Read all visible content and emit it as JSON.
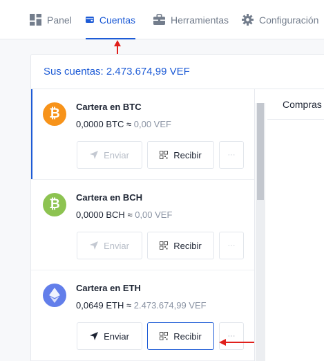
{
  "nav": {
    "items": [
      {
        "label": "Panel",
        "icon": "dashboard-icon"
      },
      {
        "label": "Cuentas",
        "icon": "wallet-icon",
        "active": true
      },
      {
        "label": "Herramientas",
        "icon": "briefcase-icon"
      },
      {
        "label": "Configuración",
        "icon": "gear-icon"
      }
    ]
  },
  "accounts": {
    "total_label": "Sus cuentas: 2.473.674,99 VEF"
  },
  "wallets": [
    {
      "name": "Cartera en BTC",
      "amount": "0,0000 BTC",
      "approx": "≈",
      "fiat": "0,00 VEF",
      "coin_icon": "bitcoin-icon",
      "coin_color": "#f7931a",
      "coin_symbol": "₿",
      "send_label": "Enviar",
      "receive_label": "Recibir",
      "more_label": "···",
      "send_enabled": false
    },
    {
      "name": "Cartera en BCH",
      "amount": "0,0000 BCH",
      "approx": "≈",
      "fiat": "0,00 VEF",
      "coin_icon": "bitcoin-cash-icon",
      "coin_color": "#8dc351",
      "coin_symbol": "₿",
      "send_label": "Enviar",
      "receive_label": "Recibir",
      "more_label": "···",
      "send_enabled": false
    },
    {
      "name": "Cartera en ETH",
      "amount": "0,0649 ETH",
      "approx": "≈",
      "fiat": "2.473.674,99 VEF",
      "coin_icon": "ethereum-icon",
      "coin_color": "#627eea",
      "coin_symbol": "◆",
      "send_label": "Enviar",
      "receive_label": "Recibir",
      "more_label": "···",
      "send_enabled": true
    }
  ],
  "right_tab": {
    "label": "Compras"
  },
  "colors": {
    "accent": "#1d5bd6",
    "annotation": "#e0201b"
  }
}
